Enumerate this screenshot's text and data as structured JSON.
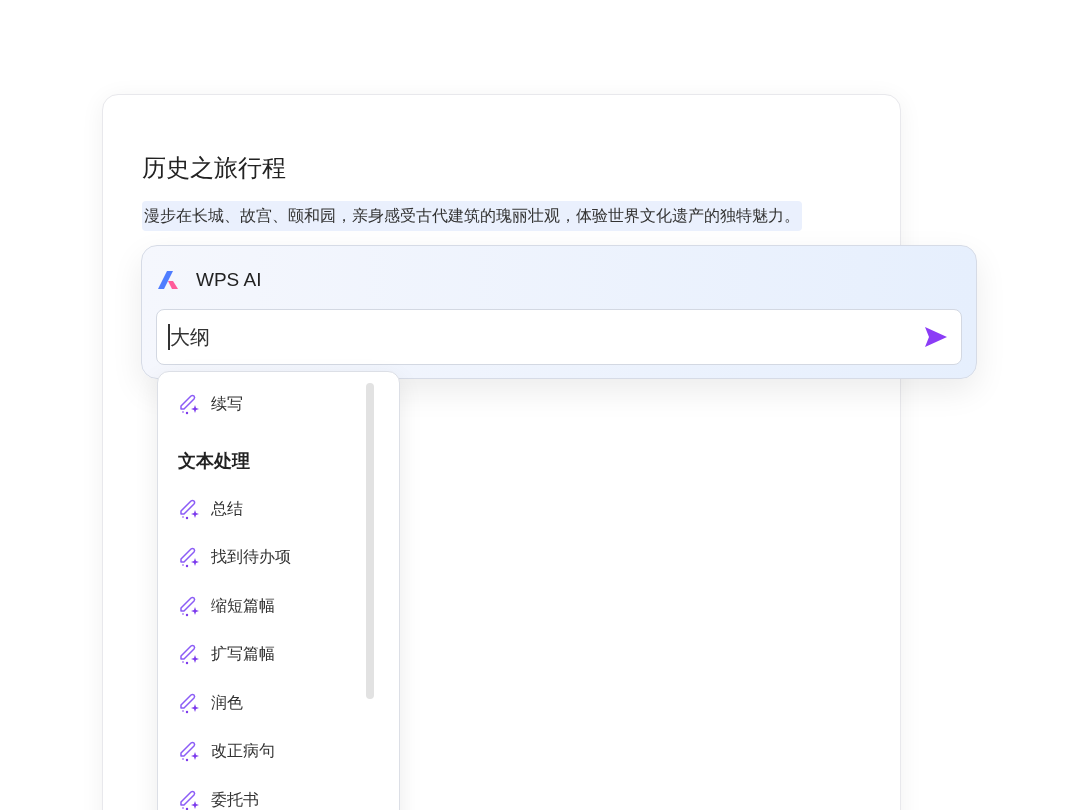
{
  "document": {
    "title": "历史之旅行程",
    "paragraph": "漫步在长城、故宫、颐和园，亲身感受古代建筑的瑰丽壮观，体验世界文化遗产的独特魅力。"
  },
  "ai_panel": {
    "title": "WPS AI",
    "input": {
      "value": "大纲"
    }
  },
  "menu": [
    {
      "kind": "item",
      "label": "续写"
    },
    {
      "kind": "heading",
      "label": "文本处理"
    },
    {
      "kind": "item",
      "label": "总结"
    },
    {
      "kind": "item",
      "label": "找到待办项"
    },
    {
      "kind": "item",
      "label": "缩短篇幅"
    },
    {
      "kind": "item",
      "label": "扩写篇幅"
    },
    {
      "kind": "item",
      "label": "润色"
    },
    {
      "kind": "item",
      "label": "改正病句"
    },
    {
      "kind": "item",
      "label": "委托书"
    }
  ]
}
